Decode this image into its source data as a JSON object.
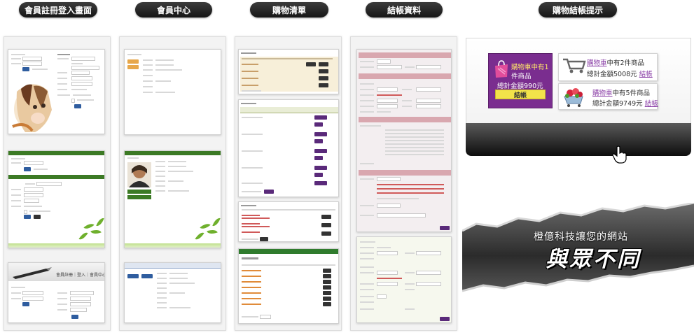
{
  "sections": [
    {
      "label": "會員註冊登入畫面"
    },
    {
      "label": "會員中心"
    },
    {
      "label": "購物清單"
    },
    {
      "label": "結帳資料"
    },
    {
      "label": "購物結帳提示"
    }
  ],
  "login_header": "會員註冊｜登入｜會員中心",
  "cart_popup": {
    "purple": {
      "line1": "購物車中有1",
      "line2": "件商品",
      "line3": "總計金額990元",
      "button": "結帳"
    },
    "card1": {
      "link": "購物車",
      "rest": "中有2件商品",
      "total": "總計金額5008元",
      "checkout": "結帳"
    },
    "card2": {
      "link": "購物車",
      "rest": "中有5件商品",
      "total": "總計金額9749元",
      "checkout": "結帳"
    }
  },
  "banner": {
    "line1": "橙億科技讓您的網站",
    "line2": "與眾不同"
  },
  "colors": {
    "pill": "#1f1f1f",
    "purple": "#7a2d8f",
    "yellow": "#f3e34a",
    "green": "#3c7a25",
    "pink": "#d9a7af"
  }
}
